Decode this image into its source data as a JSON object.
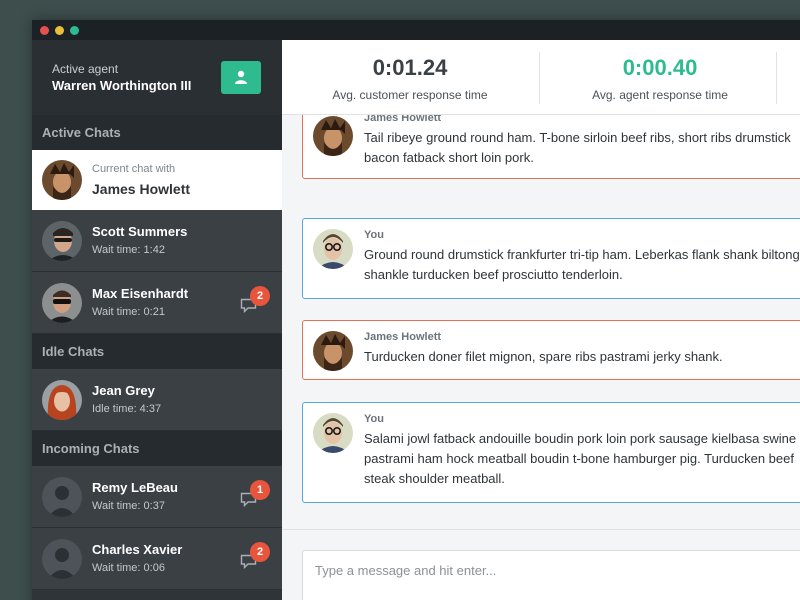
{
  "colors": {
    "accent_green": "#2ebc8f",
    "badge_red": "#e8553d",
    "customer_border": "#e3715a",
    "agent_border": "#53a7dc",
    "sidebar_bg": "#2f3438"
  },
  "agent": {
    "label": "Active agent",
    "name": "Warren Worthington III",
    "button_icon": "user-icon"
  },
  "sections": {
    "active": "Active Chats",
    "idle": "Idle Chats",
    "incoming": "Incoming Chats"
  },
  "current_chat": {
    "subtitle": "Current chat with",
    "name": "James Howlett"
  },
  "active_chats": [
    {
      "name": "Scott Summers",
      "wait": "Wait time: 1:42"
    },
    {
      "name": "Max Eisenhardt",
      "wait": "Wait time: 0:21",
      "unread": "2"
    }
  ],
  "idle_chats": [
    {
      "name": "Jean Grey",
      "wait": "Idle time: 4:37"
    }
  ],
  "incoming_chats": [
    {
      "name": "Remy LeBeau",
      "wait": "Wait time: 0:37",
      "unread": "1"
    },
    {
      "name": "Charles Xavier",
      "wait": "Wait time: 0:06",
      "unread": "2"
    }
  ],
  "stats": [
    {
      "value": "0:01.24",
      "label": "Avg. customer response time",
      "color": "#3b4045"
    },
    {
      "value": "0:00.40",
      "label": "Avg. agent response time",
      "color": "#2ebc8f"
    }
  ],
  "messages": [
    {
      "from": "James Howlett",
      "lines": [
        "Tail ribeye ground round ham. T-bone sirloin beef ribs, short ribs drumstick",
        "bacon fatback short loin pork."
      ]
    },
    {
      "from": "You",
      "lines": [
        "Ground round drumstick frankfurter tri-tip ham. Leberkas flank shank biltong",
        "shankle turducken beef prosciutto tenderloin."
      ]
    },
    {
      "from": "James Howlett",
      "lines": [
        "Turducken doner filet mignon, spare ribs pastrami jerky shank."
      ]
    },
    {
      "from": "You",
      "lines": [
        "Salami jowl fatback andouille boudin pork loin pork sausage kielbasa swine",
        "pastrami ham hock meatball boudin t-bone hamburger pig. Turducken beef",
        "steak shoulder meatball."
      ]
    }
  ],
  "composer": {
    "placeholder": "Type a message and hit enter..."
  }
}
